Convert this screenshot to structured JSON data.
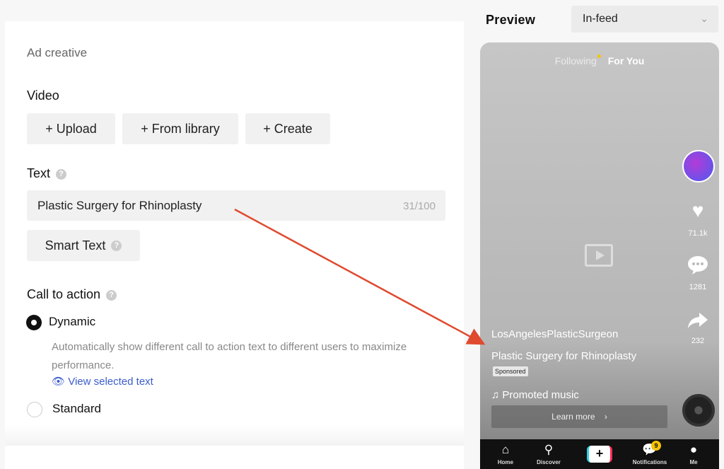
{
  "form": {
    "section_title": "Ad creative",
    "video_label": "Video",
    "upload_label": "+ Upload",
    "library_label": "+ From library",
    "create_label": "+ Create",
    "text_label": "Text",
    "text_value": "Plastic Surgery for Rhinoplasty",
    "text_count": "31/100",
    "smart_text_label": "Smart Text",
    "cta_label": "Call to action",
    "dynamic_label": "Dynamic",
    "dynamic_desc": "Automatically show different call to action text to different users to maximize performance.",
    "view_selected_label": "View selected text",
    "standard_label": "Standard",
    "cta_selected": "Dynamic"
  },
  "preview": {
    "title": "Preview",
    "placement": "In-feed",
    "tab_following": "Following",
    "tab_foryou": "For You",
    "likes": "71.1k",
    "comments": "1281",
    "shares": "232",
    "handle": "LosAngelesPlasticSurgeon",
    "caption": "Plastic Surgery for Rhinoplasty",
    "sponsored": "Sponsored",
    "music": "♫ Promoted music",
    "learn_more": "Learn more",
    "nav": {
      "home": "Home",
      "discover": "Discover",
      "notifications": "Notifications",
      "notifications_badge": "9",
      "me": "Me"
    }
  },
  "colors": {
    "accent_link": "#3b5ccc",
    "arrow": "#e04a2f",
    "badge": "#f5c400"
  }
}
